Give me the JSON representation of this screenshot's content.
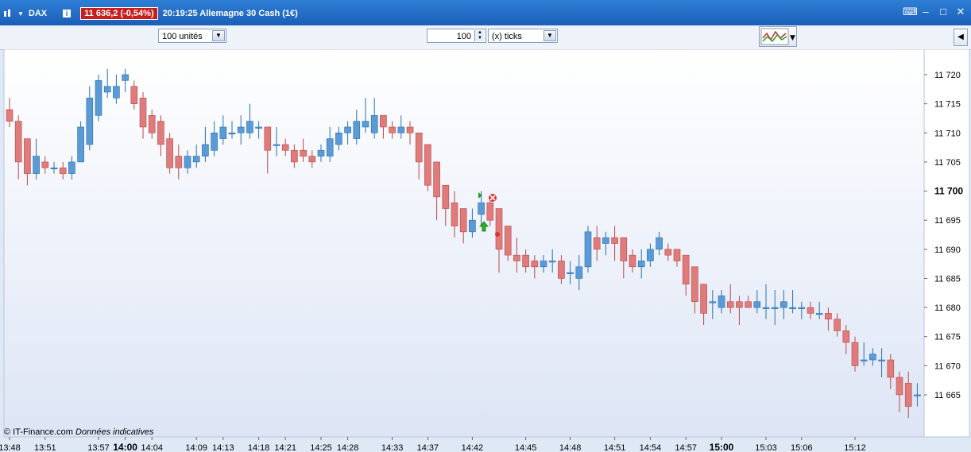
{
  "window": {
    "symbol": "DAX",
    "price_badge": "11 636,2 (-0,54%)",
    "status": "20:19:25 Allemagne 30 Cash (1€)"
  },
  "toolbar": {
    "units_select": "100 unités",
    "ticks_value": "100",
    "ticks_unit_select": "(x) ticks"
  },
  "footer": {
    "credit": "© IT-Finance.com",
    "note": "Données indicatives"
  },
  "colors": {
    "up": "#5b9bd5",
    "down": "#e07b7b",
    "up_border": "#2a6fb0",
    "down_border": "#b84848",
    "badge": "#c81e1e"
  },
  "chart_data": {
    "type": "candlestick",
    "ylim": [
      11660,
      11724
    ],
    "y_ticks": [
      "11 720",
      "11 715",
      "11 710",
      "11 705",
      "11 700",
      "11 695",
      "11 690",
      "11 685",
      "11 680",
      "11 675",
      "11 670",
      "11 665"
    ],
    "y_tick_values": [
      11720,
      11715,
      11710,
      11705,
      11700,
      11695,
      11690,
      11685,
      11680,
      11675,
      11670,
      11665
    ],
    "bold_tick": "11 700",
    "x_ticks": [
      "13:48",
      "13:51",
      "13:57",
      "14:00",
      "14:04",
      "14:09",
      "14:13",
      "14:18",
      "14:21",
      "14:25",
      "14:28",
      "14:33",
      "14:37",
      "14:42",
      "14:45",
      "14:48",
      "14:51",
      "14:54",
      "14:57",
      "15:00",
      "15:03",
      "15:06",
      "15:12"
    ],
    "x_tick_index": [
      0,
      4,
      10,
      13,
      16,
      21,
      24,
      28,
      31,
      35,
      38,
      43,
      47,
      52,
      58,
      63,
      68,
      72,
      76,
      80,
      85,
      89,
      95
    ],
    "bold_x_ticks": [
      "14:00",
      "15:00"
    ],
    "candles": [
      [
        11714,
        11716,
        11711,
        11712
      ],
      [
        11712,
        11713,
        11702,
        11705
      ],
      [
        11709,
        11709,
        11701,
        11703
      ],
      [
        11703,
        11709,
        11702,
        11706
      ],
      [
        11705,
        11706,
        11703,
        11704
      ],
      [
        11704,
        11705,
        11703,
        11704
      ],
      [
        11704,
        11705,
        11702,
        11703
      ],
      [
        11703,
        11706,
        11702,
        11705
      ],
      [
        11705,
        11712,
        11705,
        11711
      ],
      [
        11708,
        11718,
        11707,
        11716
      ],
      [
        11713,
        11720,
        11712,
        11719
      ],
      [
        11717,
        11721,
        11716,
        11718
      ],
      [
        11716,
        11720,
        11715,
        11718
      ],
      [
        11719,
        11721,
        11717,
        11720
      ],
      [
        11718,
        11719,
        11714,
        11715
      ],
      [
        11716,
        11717,
        11709,
        11711
      ],
      [
        11713,
        11714,
        11709,
        11710
      ],
      [
        11712,
        11713,
        11706,
        11708
      ],
      [
        11709,
        11710,
        11703,
        11704
      ],
      [
        11706,
        11708,
        11702,
        11704
      ],
      [
        11704,
        11707,
        11703,
        11706
      ],
      [
        11705,
        11708,
        11704,
        11706
      ],
      [
        11706,
        11711,
        11705,
        11708
      ],
      [
        11707,
        11712,
        11706,
        11710
      ],
      [
        11709,
        11713,
        11708,
        11711
      ],
      [
        11710,
        11712,
        11709,
        11710
      ],
      [
        11710,
        11713,
        11708,
        11711
      ],
      [
        11710,
        11715,
        11709,
        11712
      ],
      [
        11711,
        11712,
        11709,
        11711
      ],
      [
        11711,
        11711,
        11703,
        11707
      ],
      [
        11708,
        11711,
        11706,
        11708
      ],
      [
        11708,
        11709,
        11706,
        11707
      ],
      [
        11707,
        11708,
        11704,
        11705
      ],
      [
        11707,
        11709,
        11705,
        11706
      ],
      [
        11706,
        11707,
        11704,
        11705
      ],
      [
        11706,
        11708,
        11705,
        11707
      ],
      [
        11706,
        11711,
        11705,
        11709
      ],
      [
        11708,
        11711,
        11707,
        11710
      ],
      [
        11710,
        11712,
        11708,
        11711
      ],
      [
        11709,
        11714,
        11708,
        11712
      ],
      [
        11711,
        11716,
        11710,
        11712
      ],
      [
        11710,
        11716,
        11709,
        11713
      ],
      [
        11713,
        11713,
        11709,
        11711
      ],
      [
        11711,
        11712,
        11709,
        11710
      ],
      [
        11710,
        11713,
        11709,
        11711
      ],
      [
        11711,
        11712,
        11708,
        11710
      ],
      [
        11710,
        11710,
        11702,
        11705
      ],
      [
        11708,
        11708,
        11700,
        11701
      ],
      [
        11705,
        11705,
        11695,
        11699
      ],
      [
        11701,
        11701,
        11694,
        11697
      ],
      [
        11698,
        11700,
        11692,
        11694
      ],
      [
        11697,
        11697,
        11691,
        11693
      ],
      [
        11693,
        11697,
        11692,
        11695
      ],
      [
        11696,
        11700,
        11694,
        11698
      ],
      [
        11698,
        11699,
        11694,
        11695
      ],
      [
        11697,
        11697,
        11686,
        11690
      ],
      [
        11694,
        11694,
        11688,
        11689
      ],
      [
        11689,
        11692,
        11686,
        11688
      ],
      [
        11689,
        11690,
        11686,
        11687
      ],
      [
        11688,
        11689,
        11685,
        11687
      ],
      [
        11687,
        11689,
        11686,
        11688
      ],
      [
        11688,
        11690,
        11686,
        11688
      ],
      [
        11688,
        11689,
        11684,
        11685
      ],
      [
        11686,
        11688,
        11684,
        11686
      ],
      [
        11685,
        11689,
        11683,
        11687
      ],
      [
        11687,
        11694,
        11686,
        11693
      ],
      [
        11692,
        11694,
        11688,
        11690
      ],
      [
        11691,
        11693,
        11689,
        11692
      ],
      [
        11692,
        11694,
        11688,
        11691
      ],
      [
        11692,
        11692,
        11685,
        11688
      ],
      [
        11689,
        11690,
        11686,
        11687
      ],
      [
        11687,
        11690,
        11685,
        11688
      ],
      [
        11688,
        11691,
        11687,
        11690
      ],
      [
        11690,
        11693,
        11689,
        11692
      ],
      [
        11690,
        11691,
        11688,
        11689
      ],
      [
        11690,
        11690,
        11687,
        11688
      ],
      [
        11689,
        11689,
        11682,
        11684
      ],
      [
        11687,
        11687,
        11679,
        11681
      ],
      [
        11684,
        11684,
        11677,
        11679
      ],
      [
        11681,
        11683,
        11678,
        11681
      ],
      [
        11680,
        11683,
        11679,
        11682
      ],
      [
        11681,
        11684,
        11679,
        11680
      ],
      [
        11681,
        11682,
        11677,
        11680
      ],
      [
        11681,
        11682,
        11680,
        11680
      ],
      [
        11680,
        11683,
        11679,
        11681
      ],
      [
        11680,
        11684,
        11678,
        11680
      ],
      [
        11680,
        11683,
        11677,
        11680
      ],
      [
        11680,
        11683,
        11678,
        11681
      ],
      [
        11680,
        11683,
        11679,
        11680
      ],
      [
        11680,
        11681,
        11678,
        11680
      ],
      [
        11680,
        11681,
        11678,
        11679
      ],
      [
        11679,
        11681,
        11678,
        11679
      ],
      [
        11679,
        11680,
        11676,
        11678
      ],
      [
        11678,
        11679,
        11675,
        11676
      ],
      [
        11676,
        11677,
        11672,
        11674
      ],
      [
        11674,
        11675,
        11669,
        11670
      ],
      [
        11671,
        11674,
        11670,
        11671
      ],
      [
        11671,
        11673,
        11670,
        11672
      ],
      [
        11671,
        11673,
        11668,
        11671
      ],
      [
        11671,
        11672,
        11666,
        11668
      ],
      [
        11668,
        11669,
        11662,
        11665
      ],
      [
        11667,
        11669,
        11661,
        11663
      ],
      [
        11665,
        11667,
        11663,
        11665
      ]
    ]
  }
}
